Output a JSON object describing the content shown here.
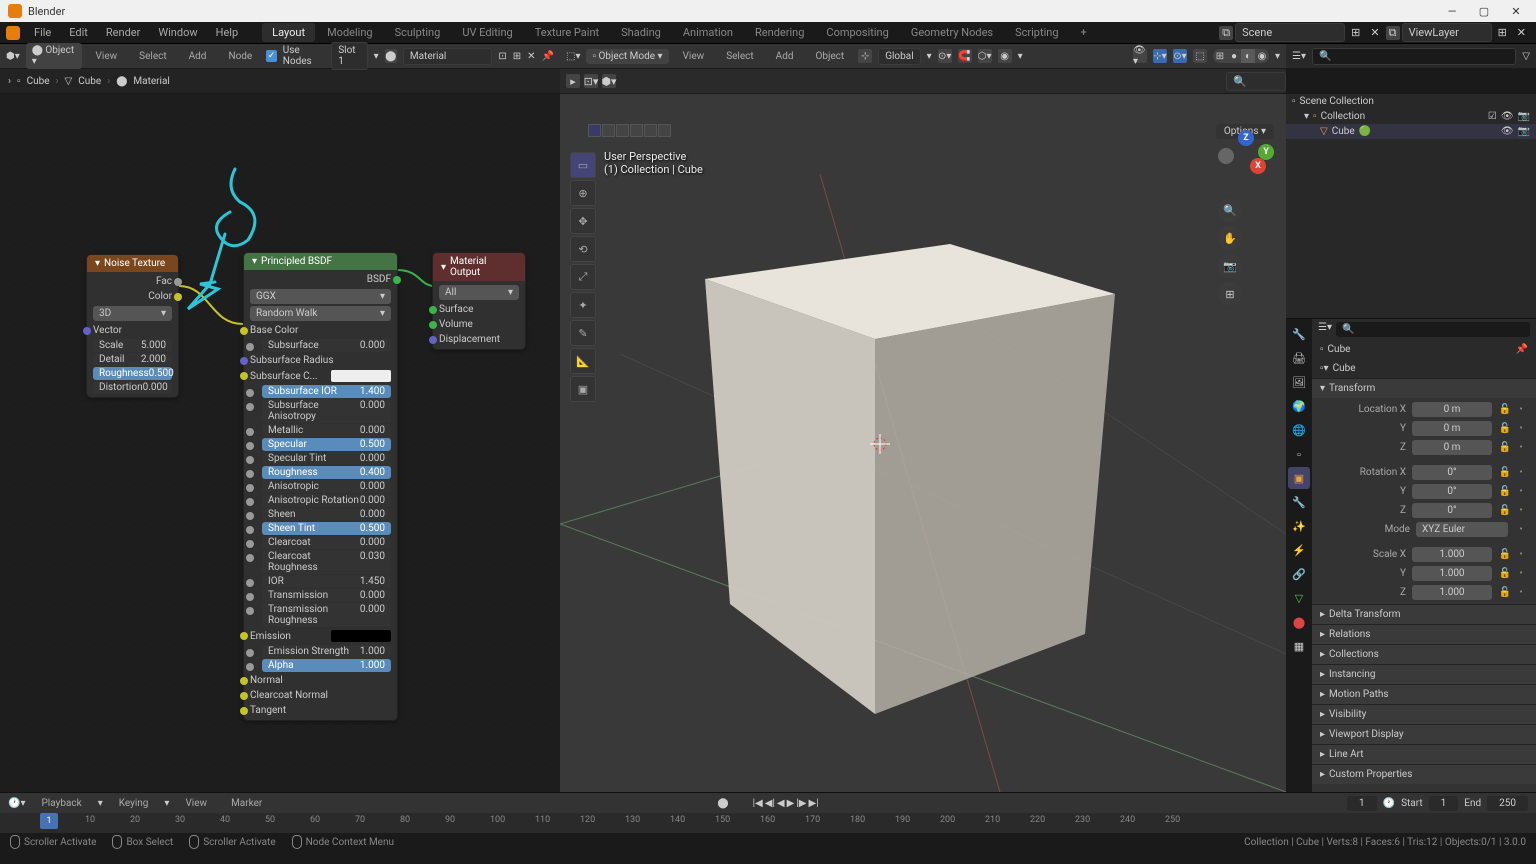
{
  "title": "Blender",
  "menu": [
    "File",
    "Edit",
    "Render",
    "Window",
    "Help"
  ],
  "workspaces": [
    "Layout",
    "Modeling",
    "Sculpting",
    "UV Editing",
    "Texture Paint",
    "Shading",
    "Animation",
    "Rendering",
    "Compositing",
    "Geometry Nodes",
    "Scripting"
  ],
  "active_workspace": "Layout",
  "scene": "Scene",
  "viewlayer": "ViewLayer",
  "node_toolbar": {
    "mode": "Object",
    "menus": [
      "View",
      "Select",
      "Add",
      "Node"
    ],
    "use_nodes_label": "Use Nodes",
    "slot": "Slot 1",
    "material": "Material"
  },
  "breadcrumb": [
    "Cube",
    "Cube",
    "Material"
  ],
  "noise_node": {
    "title": "Noise Texture",
    "outputs": [
      "Fac",
      "Color"
    ],
    "dim": "3D",
    "input_vector": "Vector",
    "rows": [
      {
        "label": "Scale",
        "value": "5.000"
      },
      {
        "label": "Detail",
        "value": "2.000"
      },
      {
        "label": "Roughness",
        "value": "0.500"
      },
      {
        "label": "Distortion",
        "value": "0.000"
      }
    ]
  },
  "bsdf_node": {
    "title": "Principled BSDF",
    "output": "BSDF",
    "dist": "GGX",
    "sss": "Random Walk",
    "rows": [
      {
        "label": "Base Color",
        "type": "input"
      },
      {
        "label": "Subsurface",
        "value": "0.000",
        "type": "dark"
      },
      {
        "label": "Subsurface Radius",
        "type": "plain"
      },
      {
        "label": "Subsurface C...",
        "type": "color"
      },
      {
        "label": "Subsurface IOR",
        "value": "1.400",
        "type": "blue"
      },
      {
        "label": "Subsurface Anisotropy",
        "value": "0.000",
        "type": "dark"
      },
      {
        "label": "Metallic",
        "value": "0.000",
        "type": "dark"
      },
      {
        "label": "Specular",
        "value": "0.500",
        "type": "blue"
      },
      {
        "label": "Specular Tint",
        "value": "0.000",
        "type": "dark"
      },
      {
        "label": "Roughness",
        "value": "0.400",
        "type": "blue"
      },
      {
        "label": "Anisotropic",
        "value": "0.000",
        "type": "dark"
      },
      {
        "label": "Anisotropic Rotation",
        "value": "0.000",
        "type": "dark"
      },
      {
        "label": "Sheen",
        "value": "0.000",
        "type": "dark"
      },
      {
        "label": "Sheen Tint",
        "value": "0.500",
        "type": "blue"
      },
      {
        "label": "Clearcoat",
        "value": "0.000",
        "type": "dark"
      },
      {
        "label": "Clearcoat Roughness",
        "value": "0.030",
        "type": "dark"
      },
      {
        "label": "IOR",
        "value": "1.450",
        "type": "dark"
      },
      {
        "label": "Transmission",
        "value": "0.000",
        "type": "dark"
      },
      {
        "label": "Transmission Roughness",
        "value": "0.000",
        "type": "dark"
      },
      {
        "label": "Emission",
        "type": "emission"
      },
      {
        "label": "Emission Strength",
        "value": "1.000",
        "type": "dark"
      },
      {
        "label": "Alpha",
        "value": "1.000",
        "type": "blue"
      },
      {
        "label": "Normal",
        "type": "input"
      },
      {
        "label": "Clearcoat Normal",
        "type": "input"
      },
      {
        "label": "Tangent",
        "type": "input"
      }
    ]
  },
  "output_node": {
    "title": "Material Output",
    "target": "All",
    "inputs": [
      "Surface",
      "Volume",
      "Displacement"
    ]
  },
  "viewport": {
    "mode": "Object Mode",
    "menus": [
      "View",
      "Select",
      "Add",
      "Object"
    ],
    "orient": "Global",
    "info1": "User Perspective",
    "info2": "(1) Collection | Cube",
    "options": "Options"
  },
  "outliner": {
    "root": "Scene Collection",
    "collection": "Collection",
    "item": "Cube"
  },
  "props": {
    "obj": "Cube",
    "data": "Cube",
    "sections": {
      "transform": "Transform",
      "delta": "Delta Transform",
      "relations": "Relations",
      "collections": "Collections",
      "instancing": "Instancing",
      "motion": "Motion Paths",
      "visibility": "Visibility",
      "viewport": "Viewport Display",
      "lineart": "Line Art",
      "custom": "Custom Properties"
    },
    "transform": {
      "loc": {
        "x": "0 m",
        "y": "0 m",
        "z": "0 m"
      },
      "rot": {
        "x": "0°",
        "y": "0°",
        "z": "0°"
      },
      "mode": "XYZ Euler",
      "scale": {
        "x": "1.000",
        "y": "1.000",
        "z": "1.000"
      }
    },
    "labels": {
      "locx": "Location X",
      "y": "Y",
      "z": "Z",
      "rotx": "Rotation X",
      "mode": "Mode",
      "scalex": "Scale X"
    }
  },
  "timeline": {
    "menus": [
      "Playback",
      "Keying",
      "View",
      "Marker"
    ],
    "frames": [
      10,
      20,
      30,
      40,
      50,
      60,
      70,
      80,
      90,
      100,
      110,
      120,
      130,
      140,
      150,
      160,
      170,
      180,
      190,
      200,
      210,
      220,
      230,
      240,
      250
    ],
    "current": "1",
    "start_label": "Start",
    "start": "1",
    "end_label": "End",
    "end": "250"
  },
  "status": {
    "items": [
      "Scroller Activate",
      "Box Select",
      "Scroller Activate",
      "Node Context Menu"
    ],
    "right": "Collection | Cube | Verts:8 | Faces:6 | Tris:12 | Objects:0/1 | 3.0.0"
  }
}
